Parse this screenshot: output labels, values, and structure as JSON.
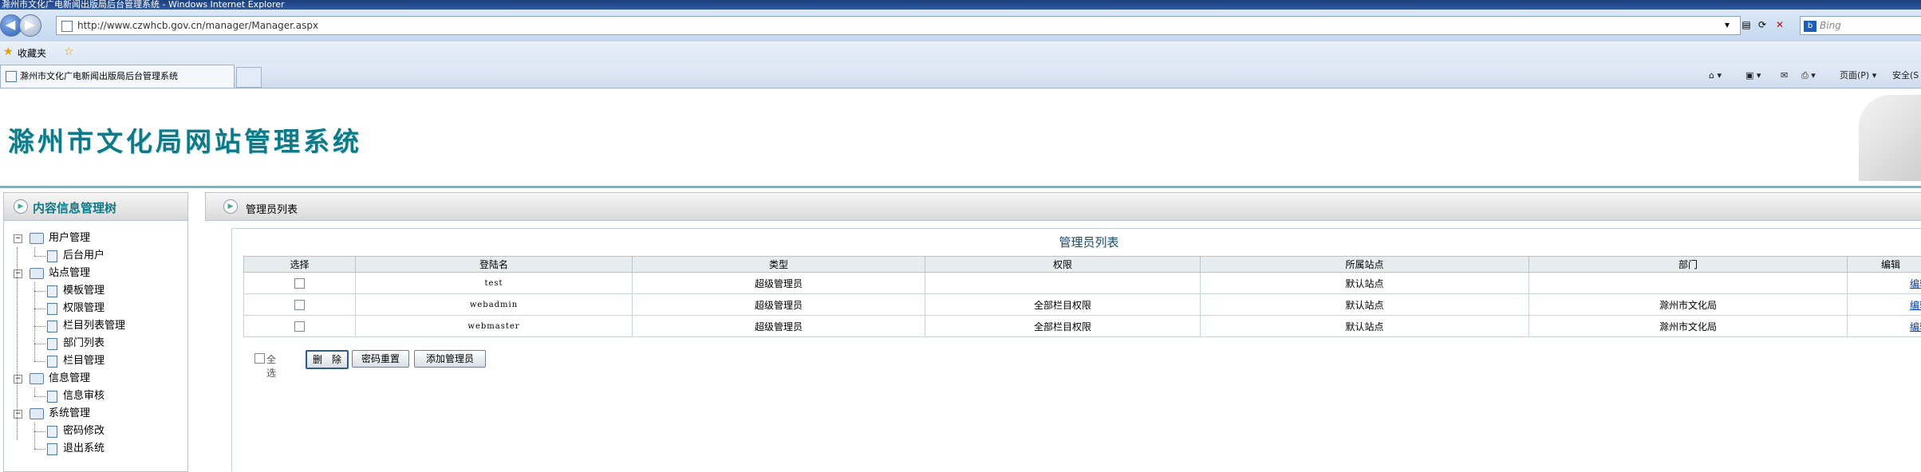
{
  "window": {
    "title": "滁州市文化广电新闻出版局后台管理系统 - Windows Internet Explorer"
  },
  "browser": {
    "url": "http://www.czwhcb.gov.cn/manager/Manager.aspx",
    "search_placeholder": "Bing",
    "favorites_label": "收藏夹",
    "tab_title": "滁州市文化广电新闻出版局后台管理系统",
    "page_menu": "页面(P) ▾",
    "safety_menu": "安全(S"
  },
  "site": {
    "title": "滁州市文化局网站管理系统"
  },
  "sidebar": {
    "title": "内容信息管理树",
    "groups": [
      {
        "label": "用户管理",
        "items": [
          "后台用户"
        ]
      },
      {
        "label": "站点管理",
        "items": [
          "模板管理",
          "权限管理",
          "栏目列表管理",
          "部门列表",
          "栏目管理"
        ]
      },
      {
        "label": "信息管理",
        "items": [
          "信息审核"
        ]
      },
      {
        "label": "系统管理",
        "items": [
          "密码修改",
          "退出系统"
        ]
      }
    ]
  },
  "main": {
    "header_title": "管理员列表",
    "list_title": "管理员列表",
    "columns": [
      "选择",
      "登陆名",
      "类型",
      "权限",
      "所属站点",
      "部门",
      "编辑"
    ],
    "rows": [
      {
        "login": "test",
        "type": "超级管理员",
        "perm": "",
        "site": "默认站点",
        "dept": "",
        "edit": "编辑"
      },
      {
        "login": "webadmin",
        "type": "超级管理员",
        "perm": "全部栏目权限",
        "site": "默认站点",
        "dept": "滁州市文化局",
        "edit": "编辑"
      },
      {
        "login": "webmaster",
        "type": "超级管理员",
        "perm": "全部栏目权限",
        "site": "默认站点",
        "dept": "滁州市文化局",
        "edit": "编辑"
      }
    ],
    "select_all_label": "全 选",
    "delete_label": "删　除",
    "reset_password_label": "密码重置",
    "add_admin_label": "添加管理员"
  }
}
